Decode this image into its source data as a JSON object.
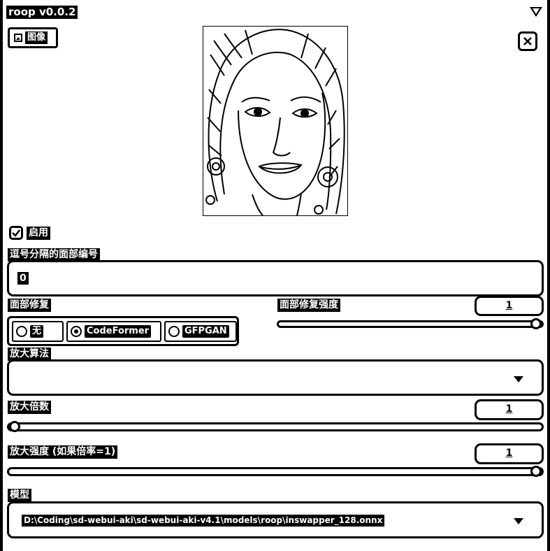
{
  "header": {
    "title": "roop v0.0.2",
    "collapse_icon": "triangle-down-icon"
  },
  "image_panel": {
    "tab_label": "图像",
    "tab_icon": "image-icon",
    "close_icon": "close-icon"
  },
  "enable": {
    "label": "启用",
    "checked": true
  },
  "face_index": {
    "label": "逗号分隔的面部编号",
    "value": "0"
  },
  "face_restore": {
    "label": "面部修复",
    "options": [
      "无",
      "CodeFormer",
      "GFPGAN"
    ],
    "selected": "CodeFormer",
    "strength_label": "面部修复强度",
    "strength_value": "1"
  },
  "upscaler": {
    "label": "放大算法",
    "value": ""
  },
  "upscale_factor": {
    "label": "放大倍数",
    "value": "1"
  },
  "upscale_strength": {
    "label": "放大强度 (如果倍率=1)",
    "value": "1"
  },
  "model": {
    "label": "模型",
    "value": "D:\\Coding\\sd-webui-aki\\sd-webui-aki-v4.1\\models\\roop\\inswapper_128.onnx"
  }
}
